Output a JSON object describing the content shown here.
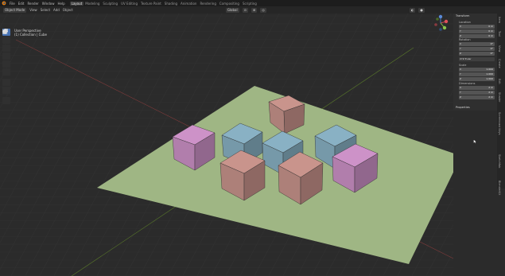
{
  "menu": [
    "File",
    "Edit",
    "Render",
    "Window",
    "Help"
  ],
  "workspaces": [
    "Layout",
    "Modeling",
    "Sculpting",
    "UV Editing",
    "Texture Paint",
    "Shading",
    "Animation",
    "Rendering",
    "Compositing",
    "Scripting"
  ],
  "active_workspace_index": 0,
  "header": {
    "mode": "Object Mode",
    "menus": [
      "View",
      "Select",
      "Add",
      "Object"
    ],
    "orientation": "Global"
  },
  "viewport": {
    "perspective": "User Perspective",
    "collection": "(1) Collection | Cube"
  },
  "npanel": {
    "transform_title": "Transform",
    "location_label": "Location",
    "location": [
      {
        "axis": "X",
        "value": "0 m"
      },
      {
        "axis": "Y",
        "value": "0 m"
      },
      {
        "axis": "Z",
        "value": "0 m"
      }
    ],
    "rotation_label": "Rotation",
    "rotation": [
      {
        "axis": "X",
        "value": "0°"
      },
      {
        "axis": "Y",
        "value": "0°"
      },
      {
        "axis": "Z",
        "value": "0°"
      }
    ],
    "rotation_mode": "XYZ Euler",
    "scale_label": "Scale",
    "scale": [
      {
        "axis": "X",
        "value": "1.000"
      },
      {
        "axis": "Y",
        "value": "1.000"
      },
      {
        "axis": "Z",
        "value": "1.000"
      }
    ],
    "dimensions_label": "Dimensions",
    "dimensions": [
      {
        "axis": "X",
        "value": "2 m"
      },
      {
        "axis": "Y",
        "value": "2 m"
      },
      {
        "axis": "Z",
        "value": "2 m"
      }
    ],
    "properties_title": "Properties"
  },
  "side_tabs": [
    "Item",
    "Tool",
    "View",
    "Create",
    "Edit",
    "Shader",
    "Screencast Keys",
    "Sketchfab",
    "BlenderKit"
  ],
  "colors": {
    "plane": "#9fb684",
    "pink": "#c98fc4",
    "salmon": "#c59189",
    "blue": "#86aec0",
    "accent": "#4772b3"
  }
}
